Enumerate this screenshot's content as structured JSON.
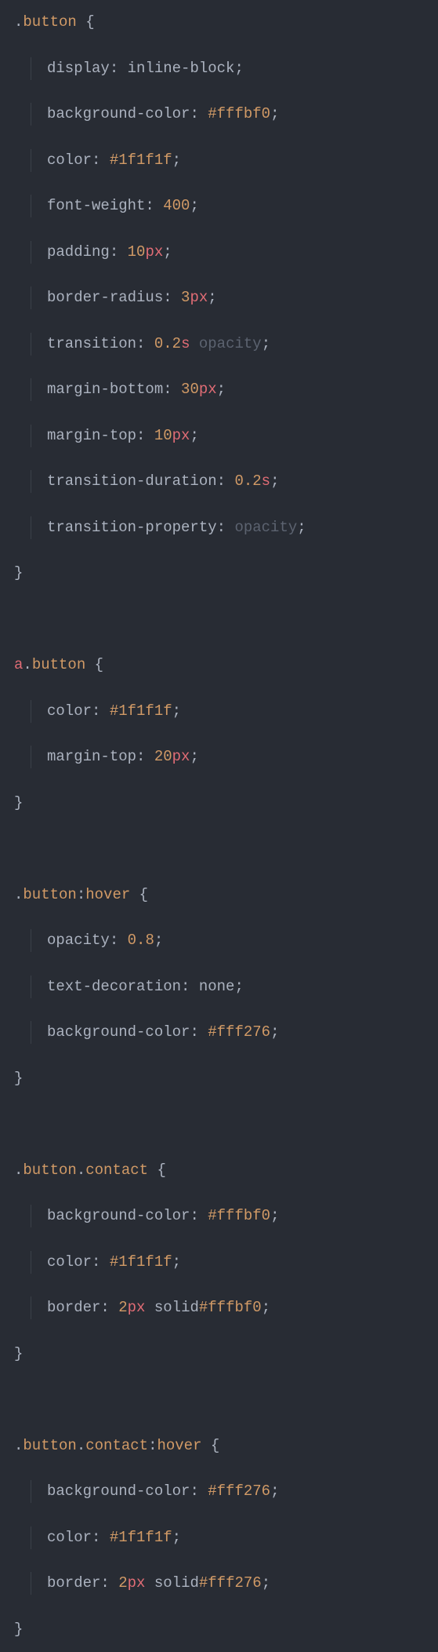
{
  "t": {
    "dot": ".",
    "colon_sel": ":",
    "button": "button",
    "a": "a",
    "contact": "contact",
    "hover": "hover",
    "obrace": " {",
    "cbrace": "}",
    "semi": ";",
    "colon": ": ",
    "display": "display",
    "inline_block": "inline-block",
    "background_color": "background-color",
    "fffbf0": "#fffbf0",
    "color": "color",
    "c1f1f1f": "#1f1f1f",
    "font_weight": "font-weight",
    "w400": "400",
    "padding": "padding",
    "v10": "10",
    "px": "px",
    "border_radius": "border-radius",
    "v3": "3",
    "transition": "transition",
    "v02": "0.2",
    "s": "s",
    "opacity_word": "opacity",
    "margin_bottom": "margin-bottom",
    "v30": "30",
    "margin_top": "margin-top",
    "transition_duration": "transition-duration",
    "transition_property": "transition-property",
    "v20": "20",
    "opacity_prop": "opacity",
    "v08": "0.8",
    "text_decoration": "text-decoration",
    "none": "none",
    "fff276": "#fff276",
    "border": "border",
    "v2": "2",
    "solid": "solid",
    "sp": " "
  }
}
